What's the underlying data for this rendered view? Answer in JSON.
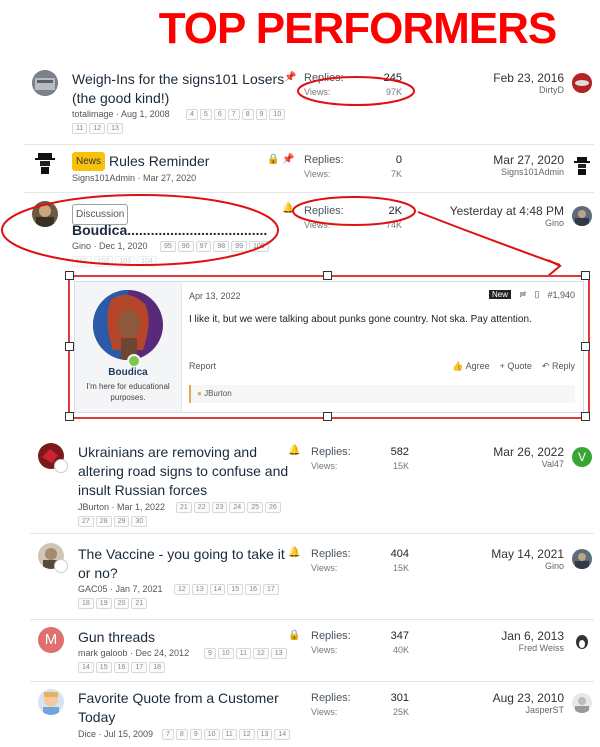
{
  "header": {
    "title": "TOP PERFORMERS"
  },
  "labels": {
    "replies": "Replies:",
    "views": "Views:"
  },
  "threads": [
    {
      "title": "Weigh-Ins for the signs101 Losers (the good kind!)",
      "author": "totalimage",
      "date": "Aug 1, 2008",
      "pages": [
        "4",
        "5",
        "6",
        "7",
        "8",
        "9",
        "10",
        "11",
        "12",
        "13"
      ],
      "replies": "245",
      "views": "97K",
      "latest_date": "Feb 23, 2016",
      "latest_user": "DirtyD"
    },
    {
      "badge": "News",
      "title": "Rules Reminder",
      "author": "Signs101Admin",
      "date": "Mar 27, 2020",
      "replies": "0",
      "views": "7K",
      "latest_date": "Mar 27, 2020",
      "latest_user": "Signs101Admin"
    },
    {
      "badge": "Discussion",
      "title": "Boudica....................................",
      "author": "Gino",
      "date": "Dec 1, 2020",
      "pages": [
        "95",
        "96",
        "97",
        "98",
        "99",
        "100",
        "101",
        "102",
        "103",
        "104"
      ],
      "replies": "2K",
      "views": "74K",
      "latest_date": "Yesterday at 4:48 PM",
      "latest_user": "Gino"
    },
    {
      "title": "Ukrainians are removing and altering road signs to confuse and insult Russian forces",
      "author": "JBurton",
      "date": "Mar 1, 2022",
      "pages": [
        "21",
        "22",
        "23",
        "24",
        "25",
        "26",
        "27",
        "28",
        "29",
        "30"
      ],
      "replies": "582",
      "views": "15K",
      "latest_date": "Mar 26, 2022",
      "latest_user": "Val47",
      "latest_avatar_letter": "V"
    },
    {
      "title": "The Vaccine - you going to take it or no?",
      "author": "GAC05",
      "date": "Jan 7, 2021",
      "pages": [
        "12",
        "13",
        "14",
        "15",
        "16",
        "17",
        "18",
        "19",
        "20",
        "21"
      ],
      "replies": "404",
      "views": "15K",
      "latest_date": "May 14, 2021",
      "latest_user": "Gino"
    },
    {
      "title": "Gun threads",
      "author": "mark galoob",
      "date": "Dec 24, 2012",
      "pages": [
        "9",
        "10",
        "11",
        "12",
        "13",
        "14",
        "15",
        "16",
        "17",
        "18"
      ],
      "replies": "347",
      "views": "40K",
      "latest_date": "Jan 6, 2013",
      "latest_user": "Fred Weiss",
      "avatar_letter": "M"
    },
    {
      "title": "Favorite Quote from a Customer Today",
      "author": "Dice",
      "date": "Jul 15, 2009",
      "pages": [
        "7",
        "8",
        "9",
        "10",
        "11",
        "12",
        "13",
        "14"
      ],
      "replies": "301",
      "views": "25K",
      "latest_date": "Aug 23, 2010",
      "latest_user": "JasperST"
    }
  ],
  "post": {
    "date": "Apr 13, 2022",
    "new_badge": "New",
    "number": "#1,940",
    "text": "I like it, but we were talking about punks gone country. Not ska. Pay attention.",
    "user_name": "Boudica",
    "user_title": "I'm here for educational purposes.",
    "report": "Report",
    "agree": "Agree",
    "quote": "+ Quote",
    "reply": "Reply",
    "reaction_user": "JBurton"
  },
  "colors": {
    "annotation_red": "#e01010",
    "news_badge": "#f8c20c",
    "link": "#1b2a3a"
  }
}
